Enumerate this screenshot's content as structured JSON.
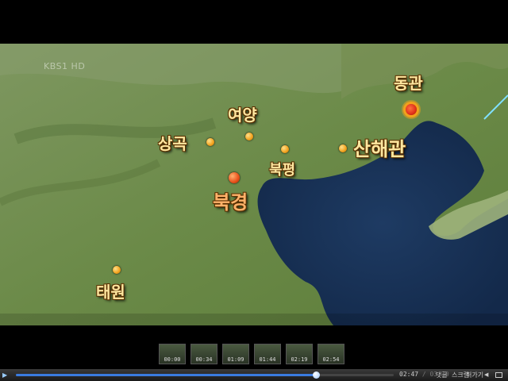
{
  "video": {
    "watermark": "KBS1 HD",
    "cities": [
      {
        "name": "동관",
        "kind": "pass"
      },
      {
        "name": "여양",
        "kind": "city"
      },
      {
        "name": "상곡",
        "kind": "city"
      },
      {
        "name": "북평",
        "kind": "city"
      },
      {
        "name": "산해관",
        "kind": "city"
      },
      {
        "name": "북경",
        "kind": "capital"
      },
      {
        "name": "태원",
        "kind": "city"
      }
    ]
  },
  "thumbnails": [
    {
      "time": "00:00"
    },
    {
      "time": "00:34"
    },
    {
      "time": "01:09"
    },
    {
      "time": "01:44"
    },
    {
      "time": "02:19"
    },
    {
      "time": "02:54"
    }
  ],
  "player": {
    "current_time": "02:47",
    "separator": " / ",
    "total_time": "03:30",
    "progress_fraction": 0.795,
    "play_icon": "play-icon",
    "buttons": {
      "comment": "댓글",
      "embed": "퍼가기",
      "share": "스크랩"
    }
  },
  "colors": {
    "water": "#1b3556",
    "land": "#6d8a4c",
    "label": "#ffe7a0",
    "progress": "#3a7be0"
  }
}
